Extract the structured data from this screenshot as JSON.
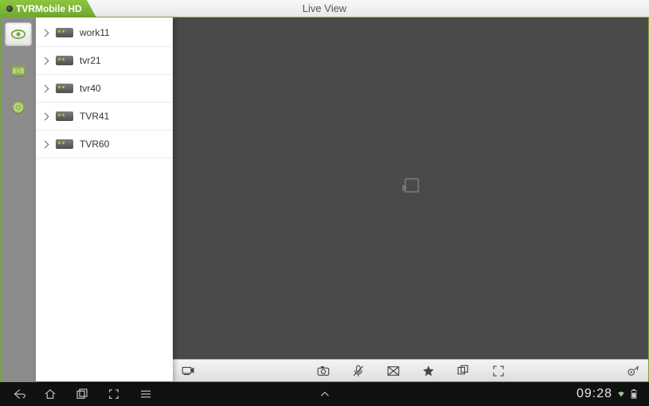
{
  "header": {
    "app_name": "TVRMobile HD",
    "title": "Live View"
  },
  "nav": {
    "items": [
      {
        "name": "live-view",
        "active": true
      },
      {
        "name": "playback",
        "active": false
      },
      {
        "name": "settings",
        "active": false
      }
    ]
  },
  "devices": {
    "items": [
      {
        "label": "work11"
      },
      {
        "label": "tvr21"
      },
      {
        "label": "tvr40"
      },
      {
        "label": "TVR41"
      },
      {
        "label": "TVR60"
      }
    ]
  },
  "toolbar": {
    "buttons": [
      "stream-switch",
      "snapshot",
      "mic",
      "quality",
      "favorite",
      "multi-view",
      "fullscreen"
    ],
    "right_button": "ptz"
  },
  "sysbar": {
    "clock": "09:28"
  }
}
